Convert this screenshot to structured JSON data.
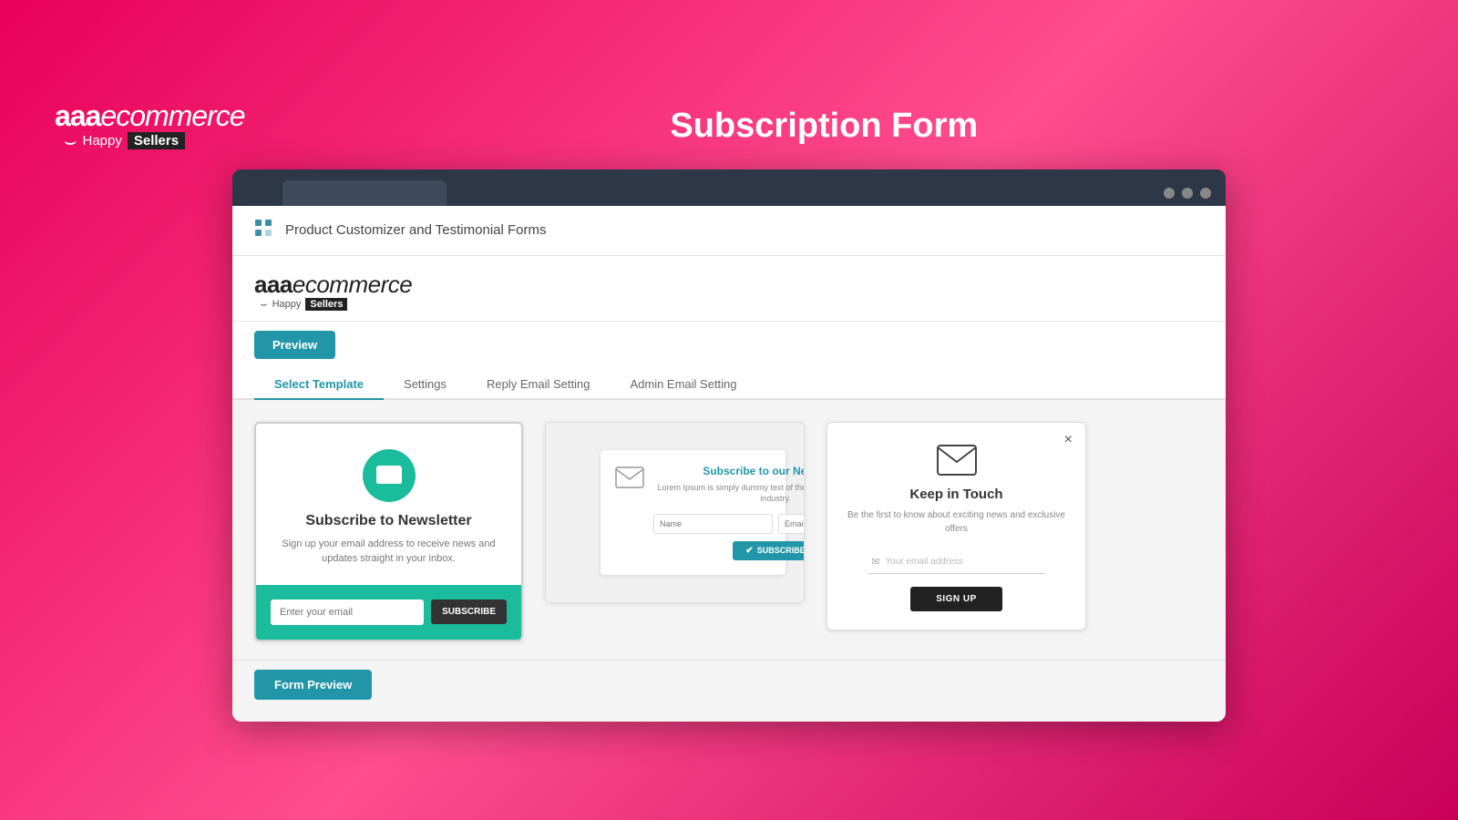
{
  "header": {
    "logo_brand": "aaa",
    "logo_italic": "ecommerce",
    "logo_happy": "Happy",
    "logo_sellers": "Sellers",
    "page_title": "Subscription Form"
  },
  "browser": {
    "tab_label": "",
    "dots": [
      "dot1",
      "dot2",
      "dot3"
    ]
  },
  "app": {
    "header_title": "Product Customizer and Testimonial Forms",
    "brand_name": "aaa",
    "brand_italic": "ecommerce",
    "brand_happy": "Happy",
    "brand_sellers": "Sellers"
  },
  "preview_button": "Preview",
  "tabs": [
    {
      "label": "Select Template",
      "active": true
    },
    {
      "label": "Settings",
      "active": false
    },
    {
      "label": "Reply Email Setting",
      "active": false
    },
    {
      "label": "Admin Email Setting",
      "active": false
    }
  ],
  "templates": {
    "card1": {
      "title": "Subscribe to Newsletter",
      "description": "Sign up your email address to receive news and updates straight in your inbox.",
      "input_placeholder": "Enter your email",
      "button_label": "SUBSCRIBE"
    },
    "card2": {
      "title": "Subscribe to our Newsletter",
      "description": "Lorem Ipsum is simply dummy text of the printing and typesetting industry.",
      "name_placeholder": "Name",
      "email_placeholder": "Email",
      "button_label": "SUBSCRIBE"
    },
    "card3": {
      "title": "Keep in Touch",
      "description": "Be the first to know about exciting news and exclusive offers",
      "email_placeholder": "Your email address",
      "button_label": "SIGN UP",
      "close_icon": "×"
    }
  },
  "form_preview_button": "Form Preview"
}
